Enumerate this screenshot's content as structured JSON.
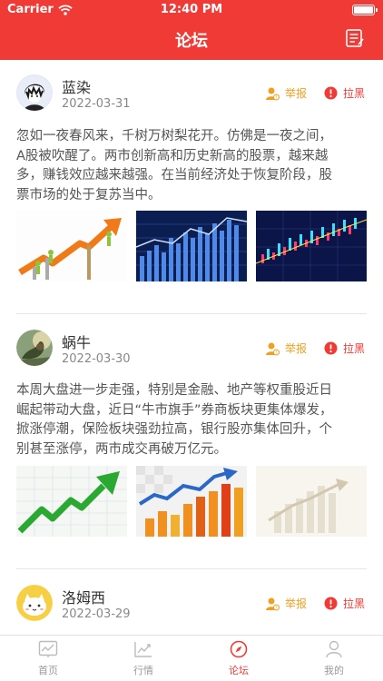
{
  "status_bar": {
    "carrier": "Carrier",
    "time": "12:40 PM"
  },
  "nav": {
    "title": "论坛"
  },
  "posts": [
    {
      "name": "蓝染",
      "date": "2022-03-31",
      "report": "举报",
      "block": "拉黑",
      "lines": [
        "忽如一夜春风来，千树万树梨花开。仿佛是一夜之间，",
        "A股被吹醒了。两市创新高和历史新高的股票，越来越",
        "多，赚钱效应越来越强。在当前经济处于恢复阶段，股",
        "票市场的处于复苏当中。"
      ]
    },
    {
      "name": "蜗牛",
      "date": "2022-03-30",
      "report": "举报",
      "block": "拉黑",
      "lines": [
        "本周大盘进一步走强，特别是金融、地产等权重股近日",
        "崛起带动大盘，近日“牛市旗手”券商板块更集体爆发，",
        "掀涨停潮，保险板块强劲拉高，银行股亦集体回升，个",
        "别甚至涨停，两市成交再破万亿元。"
      ]
    },
    {
      "name": "洛姆西",
      "date": "2022-03-29",
      "report": "举报",
      "block": "拉黑"
    }
  ],
  "tabs": [
    {
      "label": "首页"
    },
    {
      "label": "行情"
    },
    {
      "label": "论坛"
    },
    {
      "label": "我的"
    }
  ],
  "colors": {
    "brand": "#f03a35",
    "report": "#f0a020",
    "muted": "#999999"
  }
}
